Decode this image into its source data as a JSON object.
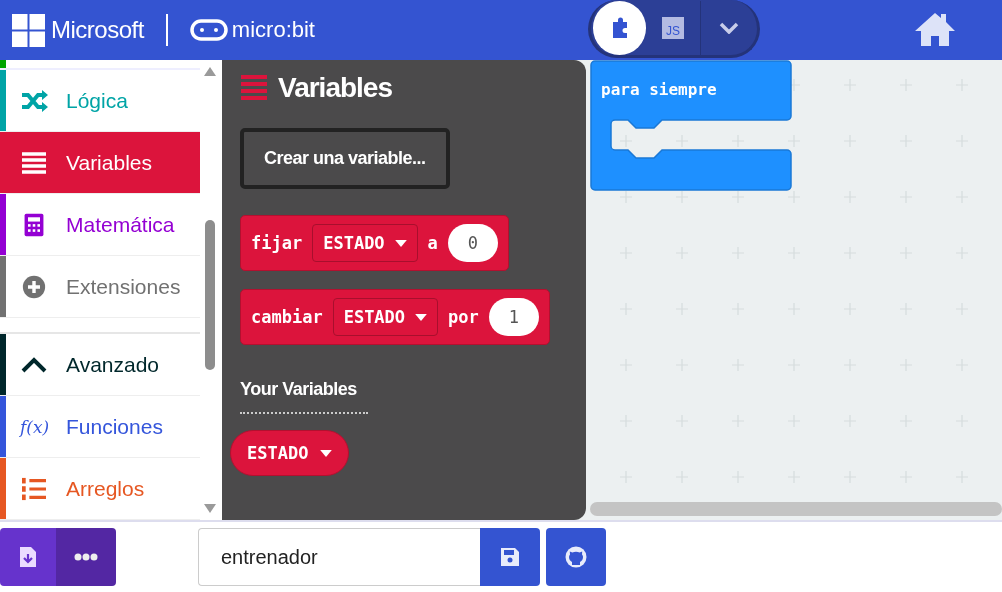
{
  "header": {
    "brand": "Microsoft",
    "product": "micro:bit",
    "editor_toggle": [
      {
        "kind": "blocks",
        "selected": true
      },
      {
        "kind": "javascript",
        "label": "JS",
        "selected": false
      }
    ]
  },
  "sidebar": {
    "partial_item": {
      "color": "#00a400"
    },
    "items": [
      {
        "label": "Lógica",
        "color": "#00a4a6",
        "selected": false
      },
      {
        "label": "Variables",
        "color": "#dc143c",
        "selected": true
      },
      {
        "label": "Matemática",
        "color": "#9400d3",
        "selected": false
      },
      {
        "label": "Extensiones",
        "color": "#717171",
        "selected": false
      }
    ],
    "advanced_items": [
      {
        "label": "Avanzado",
        "color": "#00272b",
        "selected": false
      },
      {
        "label": "Funciones",
        "color": "#3455db",
        "selected": false,
        "icon_text": "f(x)"
      },
      {
        "label": "Arreglos",
        "color": "#e65722",
        "selected": false
      }
    ]
  },
  "flyout": {
    "title": "Variables",
    "create_button": "Crear una variable...",
    "blocks": [
      {
        "keyword": "fijar",
        "variable": "ESTADO",
        "connector": "a",
        "value": "0"
      },
      {
        "keyword": "cambiar",
        "variable": "ESTADO",
        "connector": "por",
        "value": "1"
      }
    ],
    "section_title": "Your Variables",
    "variables": [
      "ESTADO"
    ]
  },
  "workspace": {
    "blocks": [
      {
        "label": "para siempre"
      }
    ]
  },
  "footer": {
    "project_name": "entrenador"
  }
}
